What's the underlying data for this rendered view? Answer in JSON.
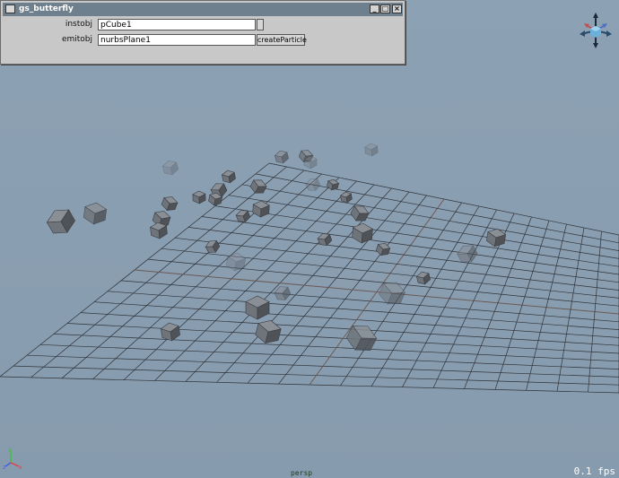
{
  "window": {
    "title": "gs_butterfly",
    "minimize_glyph": "_",
    "maximize_glyph": "□",
    "close_glyph": "×"
  },
  "form": {
    "instobj_label": "instobj",
    "instobj_value": "pCube1",
    "emitobj_label": "emitobj",
    "emitobj_value": "nurbsPlane1",
    "create_button_label": "createParticle"
  },
  "viewport": {
    "camera": "persp",
    "fps": "0.1 fps",
    "axis_labels": {
      "x": "x",
      "y": "y",
      "z": "z"
    }
  },
  "colors": {
    "background": "#8b9fb2",
    "grid": "#2f3338",
    "cube_face": "#6f747a",
    "titlebar": "#6e7f8d",
    "panel": "#c8c8c8"
  },
  "icons": {
    "window_icon": "app-icon",
    "view_cube": "view-cube-icon",
    "axis": "axis-gizmo-icon"
  }
}
